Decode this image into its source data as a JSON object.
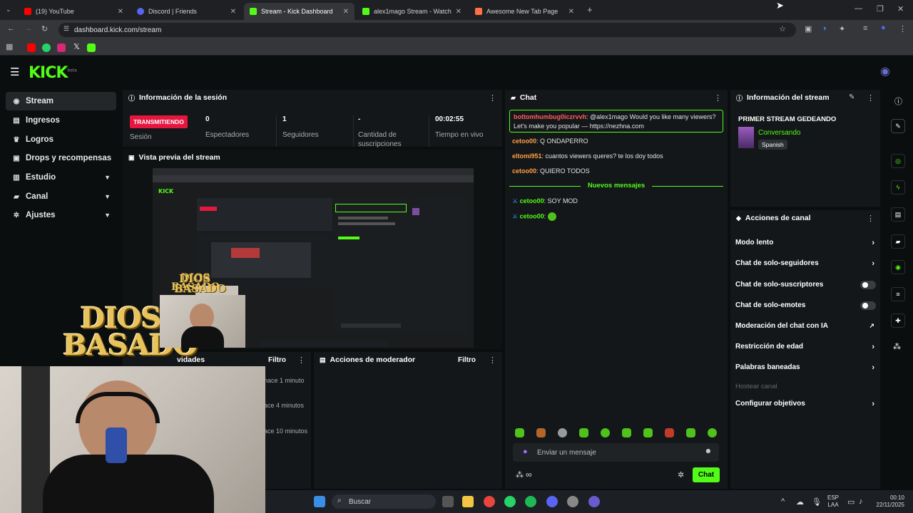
{
  "browser": {
    "tabs": [
      {
        "label": "(19) YouTube",
        "color": "#ff0000"
      },
      {
        "label": "Discord | Friends",
        "color": "#5865f2"
      },
      {
        "label": "Stream - Kick Dashboard",
        "color": "#53fc18"
      },
      {
        "label": "alex1mago Stream - Watch Live",
        "color": "#53fc18"
      },
      {
        "label": "Awesome New Tab Page",
        "color": "#ff7043"
      }
    ],
    "url": "dashboard.kick.com/stream"
  },
  "brand": {
    "logo": "KICK",
    "beta": "beta",
    "accent": "#53fc18"
  },
  "sidebar": {
    "items": [
      {
        "label": "Stream",
        "icon": "broadcast-icon"
      },
      {
        "label": "Ingresos",
        "icon": "money-icon"
      },
      {
        "label": "Logros",
        "icon": "trophy-icon"
      },
      {
        "label": "Drops y recompensas",
        "icon": "gift-icon"
      },
      {
        "label": "Estudio",
        "icon": "studio-icon"
      },
      {
        "label": "Canal",
        "icon": "channel-icon"
      },
      {
        "label": "Ajustes",
        "icon": "gear-icon"
      }
    ]
  },
  "session": {
    "title": "Información de la sesión",
    "status": "TRANSMITIENDO",
    "status_label": "Sesión",
    "spectators_value": "0",
    "spectators_label": "Espectadores",
    "followers_value": "1",
    "followers_label": "Seguidores",
    "subs_value": "-",
    "subs_label": "Cantidad de suscripciones",
    "time_value": "00:02:55",
    "time_label": "Tiempo en vivo"
  },
  "preview": {
    "title": "Vista previa del stream"
  },
  "activity": {
    "title_partial": "vidades",
    "filter": "Filtro",
    "items": [
      "hace 1 minuto",
      "ace 4 minutos",
      "ace 10 minutos"
    ]
  },
  "moderator": {
    "title": "Acciones de moderador",
    "filter": "Filtro"
  },
  "chat": {
    "title": "Chat",
    "highlight_user": "bottomhumbug0iczrvvh",
    "highlight_text": ": @alex1mago Would you like many viewers?",
    "highlight_text2": "Let's make you popular — https://nezhna.com",
    "messages": [
      {
        "user": "cetoo00",
        "text": ": Q ONDAPERRO"
      },
      {
        "user": "eltomi951",
        "text": ": cuantos viewers queres? te los doy todos"
      },
      {
        "user": "cetoo00",
        "text": ": QUIERO TODOS"
      }
    ],
    "new_messages": "Nuevos mensajes",
    "new": [
      {
        "user": "cetoo00",
        "text": ": SOY MOD"
      },
      {
        "user": "cetoo00",
        "text": ":"
      }
    ],
    "placeholder": "Enviar un mensaje",
    "send": "Chat",
    "infinity": "∞"
  },
  "stream_info": {
    "title": "Información del stream",
    "stream_title": "PRIMER STREAM GEDEANDO",
    "category": "Conversando",
    "language": "Spanish"
  },
  "channel_actions": {
    "title": "Acciones de canal",
    "items": [
      {
        "label": "Modo lento",
        "type": "arrow"
      },
      {
        "label": "Chat de solo-seguidores",
        "type": "arrow"
      },
      {
        "label": "Chat de solo-suscriptores",
        "type": "toggle"
      },
      {
        "label": "Chat de solo-emotes",
        "type": "toggle"
      },
      {
        "label": "Moderación del chat con IA",
        "type": "external"
      },
      {
        "label": "Restricción de edad",
        "type": "arrow"
      },
      {
        "label": "Palabras baneadas",
        "type": "arrow"
      },
      {
        "label": "Hostear canal",
        "type": "disabled"
      },
      {
        "label": "Configurar objetivos",
        "type": "arrow"
      }
    ]
  },
  "overlay": {
    "line1": "DIOS",
    "line2": "BASADO"
  },
  "taskbar": {
    "search": "Buscar",
    "lang1": "ESP",
    "lang2": "LAA",
    "time": "00:10",
    "date": "22/11/2025"
  }
}
